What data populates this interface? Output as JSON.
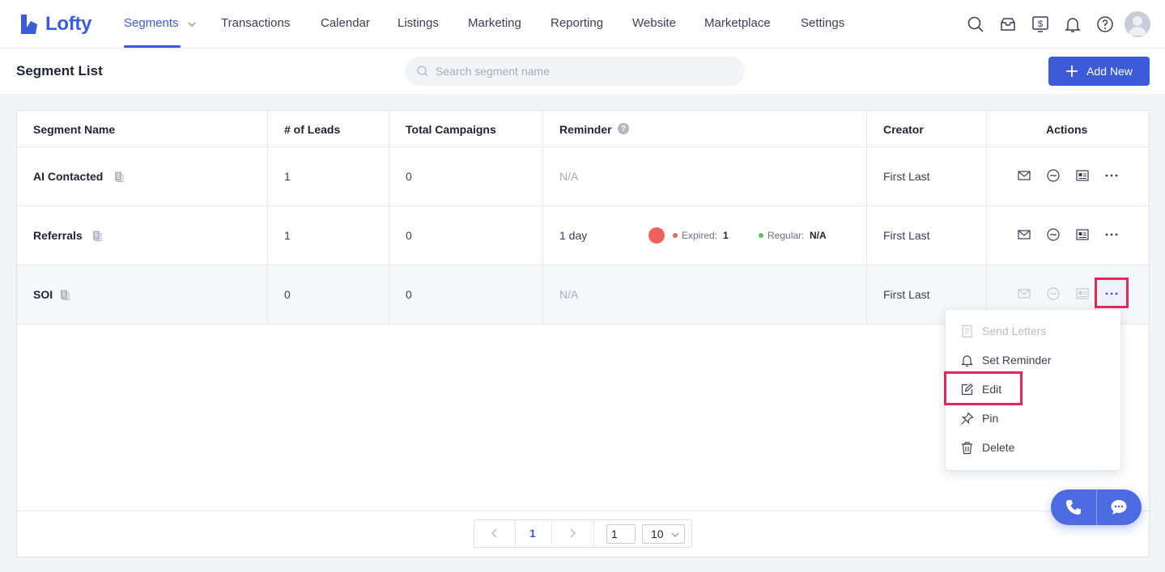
{
  "app": {
    "name": "Lofty"
  },
  "nav": {
    "items": [
      {
        "label": "Segments",
        "active": true
      },
      {
        "label": "Transactions"
      },
      {
        "label": "Calendar"
      },
      {
        "label": "Listings"
      },
      {
        "label": "Marketing"
      },
      {
        "label": "Reporting"
      },
      {
        "label": "Website"
      },
      {
        "label": "Marketplace"
      },
      {
        "label": "Settings"
      }
    ],
    "icons": [
      "search-icon",
      "inbox-icon",
      "billing-icon",
      "bell-icon",
      "help-icon",
      "avatar"
    ]
  },
  "header": {
    "title": "Segment List",
    "search_placeholder": "Search segment name",
    "add_label": "Add New"
  },
  "table": {
    "columns": [
      "Segment Name",
      "# of Leads",
      "Total Campaigns",
      "Reminder",
      "Creator",
      "Actions"
    ],
    "rows": [
      {
        "name": "AI Contacted",
        "leads": "1",
        "campaigns": "0",
        "reminder": "N/A",
        "creator": "First Last"
      },
      {
        "name": "Referrals",
        "leads": "1",
        "campaigns": "0",
        "reminder": "1 day",
        "expired_label": "Expired:",
        "expired_value": "1",
        "regular_label": "Regular:",
        "regular_value": "N/A",
        "creator": "First Last"
      },
      {
        "name": "SOI",
        "leads": "0",
        "campaigns": "0",
        "reminder": "N/A",
        "creator": "First Last"
      }
    ]
  },
  "menu": {
    "items": [
      {
        "label": "Send Letters",
        "disabled": true
      },
      {
        "label": "Set Reminder"
      },
      {
        "label": "Edit"
      },
      {
        "label": "Pin"
      },
      {
        "label": "Delete"
      }
    ]
  },
  "pagination": {
    "current": "1",
    "goto": "1",
    "page_size": "10"
  },
  "colors": {
    "accent": "#3b5bdb",
    "highlight": "#e5275a",
    "expired": "#f0625c",
    "regular": "#5cc25a"
  }
}
